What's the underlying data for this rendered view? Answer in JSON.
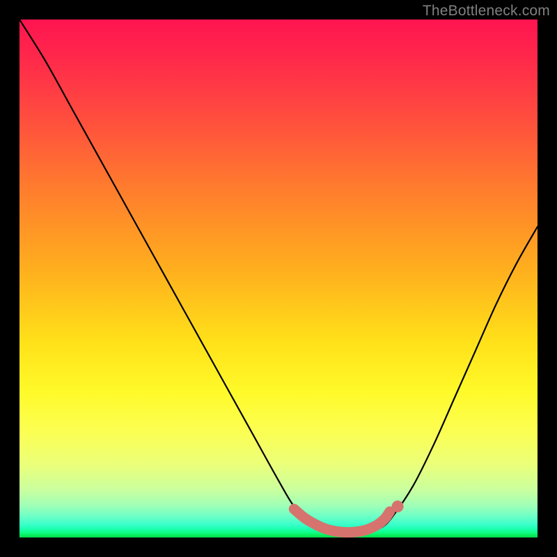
{
  "watermark": "TheBottleneck.com",
  "colors": {
    "frame": "#000000",
    "curve": "#000000",
    "marker": "#d6736e",
    "gradient_top": "#ff1450",
    "gradient_mid": "#ffe019",
    "gradient_bottom": "#06d84a"
  },
  "chart_data": {
    "type": "line",
    "title": "",
    "xlabel": "",
    "ylabel": "",
    "xlim": [
      0,
      100
    ],
    "ylim": [
      0,
      100
    ],
    "grid": false,
    "legend": false,
    "annotations": [],
    "series": [
      {
        "name": "bottleneck-curve",
        "x": [
          0,
          5,
          10,
          15,
          20,
          25,
          30,
          35,
          40,
          45,
          50,
          53,
          56,
          59,
          62,
          65,
          68,
          70,
          72,
          76,
          80,
          84,
          88,
          92,
          96,
          100
        ],
        "y": [
          100,
          92,
          83,
          74,
          65,
          56,
          47,
          38,
          29,
          20,
          11,
          6,
          3,
          1.5,
          1,
          1,
          1.5,
          2,
          4,
          10,
          18,
          27,
          36,
          45,
          53,
          60
        ]
      },
      {
        "name": "minimum-highlight",
        "x": [
          53,
          55,
          57,
          59,
          61,
          63,
          65,
          67,
          69,
          70.5,
          71.5
        ],
        "y": [
          5.5,
          3.8,
          2.6,
          1.7,
          1.2,
          1.0,
          1.1,
          1.5,
          2.4,
          3.6,
          5.0
        ]
      }
    ]
  }
}
